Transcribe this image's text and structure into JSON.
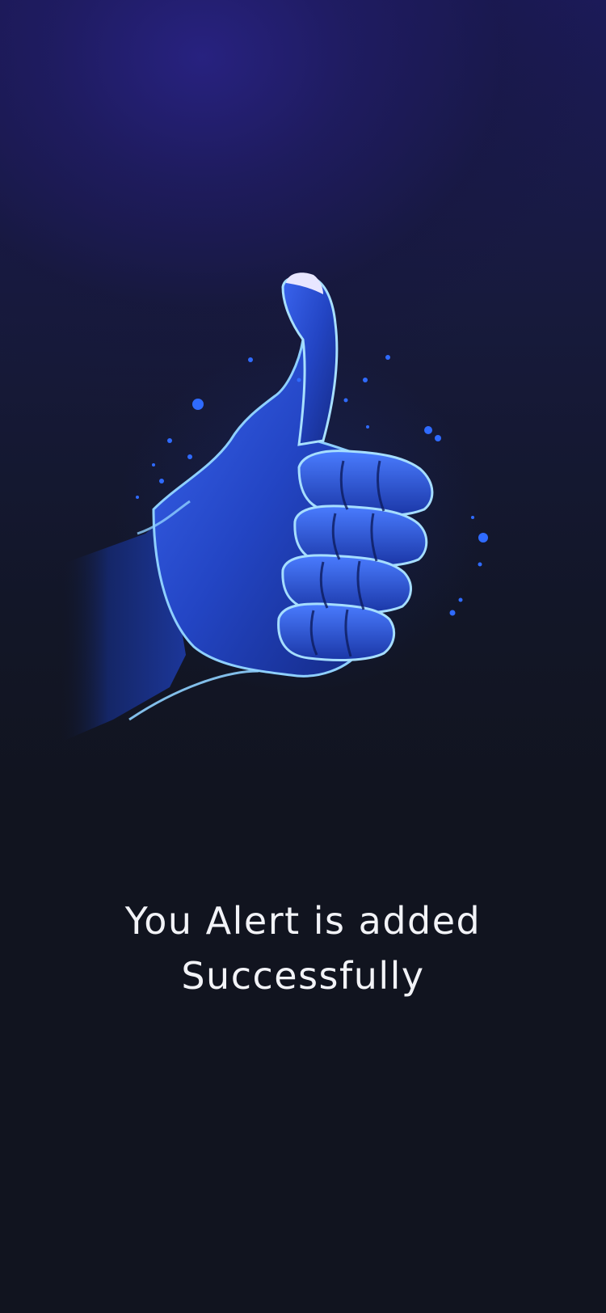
{
  "success_screen": {
    "illustration_icon": "thumbs-up-icon",
    "message_line1": "You Alert is added",
    "message_line2": "Successfully"
  },
  "colors": {
    "background_top": "#1c1a5a",
    "background_bottom": "#11141f",
    "hand_blue": "#2448c8",
    "hand_outline": "#9fd8ff",
    "text": "#f2f3f7"
  }
}
